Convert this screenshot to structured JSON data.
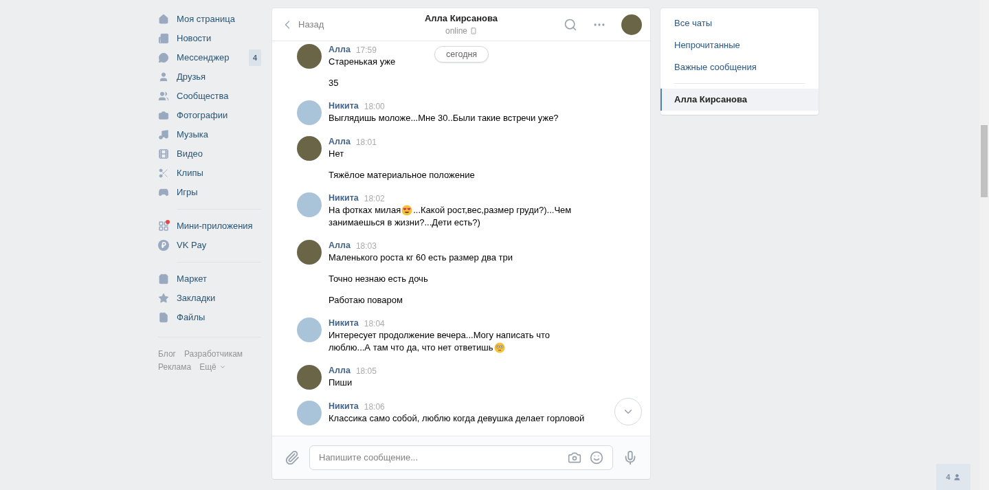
{
  "sidebar": {
    "items": [
      {
        "label": "Моя страница"
      },
      {
        "label": "Новости"
      },
      {
        "label": "Мессенджер",
        "badge": "4"
      },
      {
        "label": "Друзья"
      },
      {
        "label": "Сообщества"
      },
      {
        "label": "Фотографии"
      },
      {
        "label": "Музыка"
      },
      {
        "label": "Видео"
      },
      {
        "label": "Клипы"
      },
      {
        "label": "Игры"
      },
      {
        "kind": "divider"
      },
      {
        "label": "Мини-приложения",
        "notification": true
      },
      {
        "label": "VK Pay"
      },
      {
        "kind": "divider"
      },
      {
        "label": "Маркет"
      },
      {
        "label": "Закладки"
      },
      {
        "label": "Файлы"
      }
    ],
    "footer_links": [
      [
        "Блог",
        "Разработчикам"
      ],
      [
        "Реклама",
        "Ещё"
      ]
    ]
  },
  "chat": {
    "back": "Назад",
    "title": "Алла Кирсанова",
    "status": "online",
    "date_pill": "сегодня",
    "placeholder": "Напишите сообщение...",
    "messages": [
      {
        "sender": "Алла",
        "color": "#6b6548",
        "time": "17:59",
        "lines": [
          [
            [
              {
                "kind": "text",
                "text": "Старенькая уже"
              }
            ]
          ],
          [
            [
              {
                "kind": "text",
                "text": "35"
              }
            ]
          ]
        ]
      },
      {
        "sender": "Никита",
        "color": "#a9c4d8",
        "time": "18:00",
        "lines": [
          [
            [
              {
                "kind": "text",
                "text": "Выглядишь моложе...Мне 30..Были такие встречи уже?"
              }
            ]
          ]
        ]
      },
      {
        "sender": "Алла",
        "color": "#6b6548",
        "time": "18:01",
        "lines": [
          [
            [
              {
                "kind": "text",
                "text": "Нет"
              }
            ]
          ],
          [
            [
              {
                "kind": "text",
                "text": "Тяжёлое материальное положение"
              }
            ]
          ]
        ]
      },
      {
        "sender": "Никита",
        "color": "#a9c4d8",
        "time": "18:02",
        "lines": [
          [
            [
              {
                "kind": "text",
                "text": "На фотках милая"
              },
              {
                "kind": "heart_eyes_emoji"
              },
              {
                "kind": "text",
                "text": "...Какой рост,вес,размер груди?)...Чем"
              }
            ],
            [
              {
                "kind": "text",
                "text": "занимаешься в жизни?...Дети есть?)"
              }
            ]
          ]
        ]
      },
      {
        "sender": "Алла",
        "color": "#6b6548",
        "time": "18:03",
        "lines": [
          [
            [
              {
                "kind": "text",
                "text": "Маленького роста кг 60 есть размер два три"
              }
            ]
          ],
          [
            [
              {
                "kind": "text",
                "text": "Точно незнаю есть дочь"
              }
            ]
          ],
          [
            [
              {
                "kind": "text",
                "text": "Работаю поваром"
              }
            ]
          ]
        ]
      },
      {
        "sender": "Никита",
        "color": "#a9c4d8",
        "time": "18:04",
        "lines": [
          [
            [
              {
                "kind": "text",
                "text": "Интересует продолжение вечера...Могу написать что"
              }
            ],
            [
              {
                "kind": "text",
                "text": "люблю...А там что да, что нет ответишь"
              },
              {
                "kind": "flushed_emoji"
              }
            ]
          ]
        ]
      },
      {
        "sender": "Алла",
        "color": "#6b6548",
        "time": "18:05",
        "lines": [
          [
            [
              {
                "kind": "text",
                "text": "Пиши"
              }
            ]
          ]
        ]
      },
      {
        "sender": "Никита",
        "color": "#a9c4d8",
        "time": "18:06",
        "lines": [
          [
            [
              {
                "kind": "text",
                "text": "Классика само собой, люблю когда девушка делает горловой"
              }
            ]
          ]
        ]
      }
    ]
  },
  "chat_filters": {
    "items": [
      {
        "label": "Все чаты",
        "selected": false
      },
      {
        "label": "Непрочитанные",
        "selected": false
      },
      {
        "label": "Важные сообщения",
        "selected": false
      }
    ],
    "conversations": [
      {
        "label": "Алла Кирсанова",
        "selected": true
      }
    ]
  },
  "online_friends": {
    "count": "4"
  }
}
